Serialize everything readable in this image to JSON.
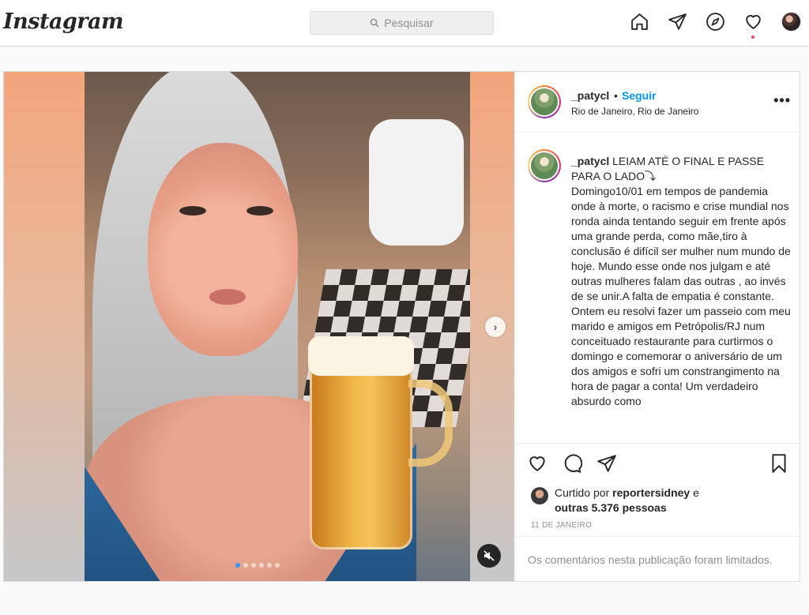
{
  "app": {
    "logo_text": "Instagram"
  },
  "search": {
    "placeholder": "Pesquisar"
  },
  "nav": {
    "icons": [
      "home-icon",
      "direct-icon",
      "explore-icon",
      "activity-icon",
      "profile-avatar"
    ],
    "activity_badge_color": "#ed4956"
  },
  "post": {
    "carousel": {
      "total_slides": 6,
      "active_slide": 1
    },
    "header": {
      "username": "_patycl",
      "separator": "•",
      "follow_label": "Seguir",
      "location": "Rio de Janeiro, Rio de Janeiro",
      "more_label": "•••"
    },
    "caption": {
      "username": "_patycl",
      "text": " LEIAM ATÉ O FINAL E PASSE PARA O LADO⤵\nDomingo10/01 em tempos de pandemia onde à morte, o racismo e crise mundial nos ronda ainda tentando seguir em frente após uma grande perda, como mãe,tiro à conclusão é difícil ser mulher num mundo de hoje. Mundo esse onde nos julgam e até outras mulheres falam das outras , ao invés de se unir.A falta de empatia é constante. Ontem eu resolvi fazer um passeio com meu marido e amigos em Petrópolis/RJ num conceituado restaurante para curtirmos o domingo e comemorar o aniversário de um dos amigos e sofri um constrangimento na hora de pagar a conta! Um verdadeiro absurdo como"
    },
    "likes": {
      "prefix": "Curtido por",
      "liker": "reportersidney",
      "connector": "e",
      "others": "outras 5.376 pessoas"
    },
    "date": "11 DE JANEIRO",
    "comments_limited": "Os comentários nesta publicação foram limitados."
  },
  "colors": {
    "link_blue": "#0095f6",
    "active_dot": "#3897f0",
    "muted_text": "#8e8e8e"
  }
}
